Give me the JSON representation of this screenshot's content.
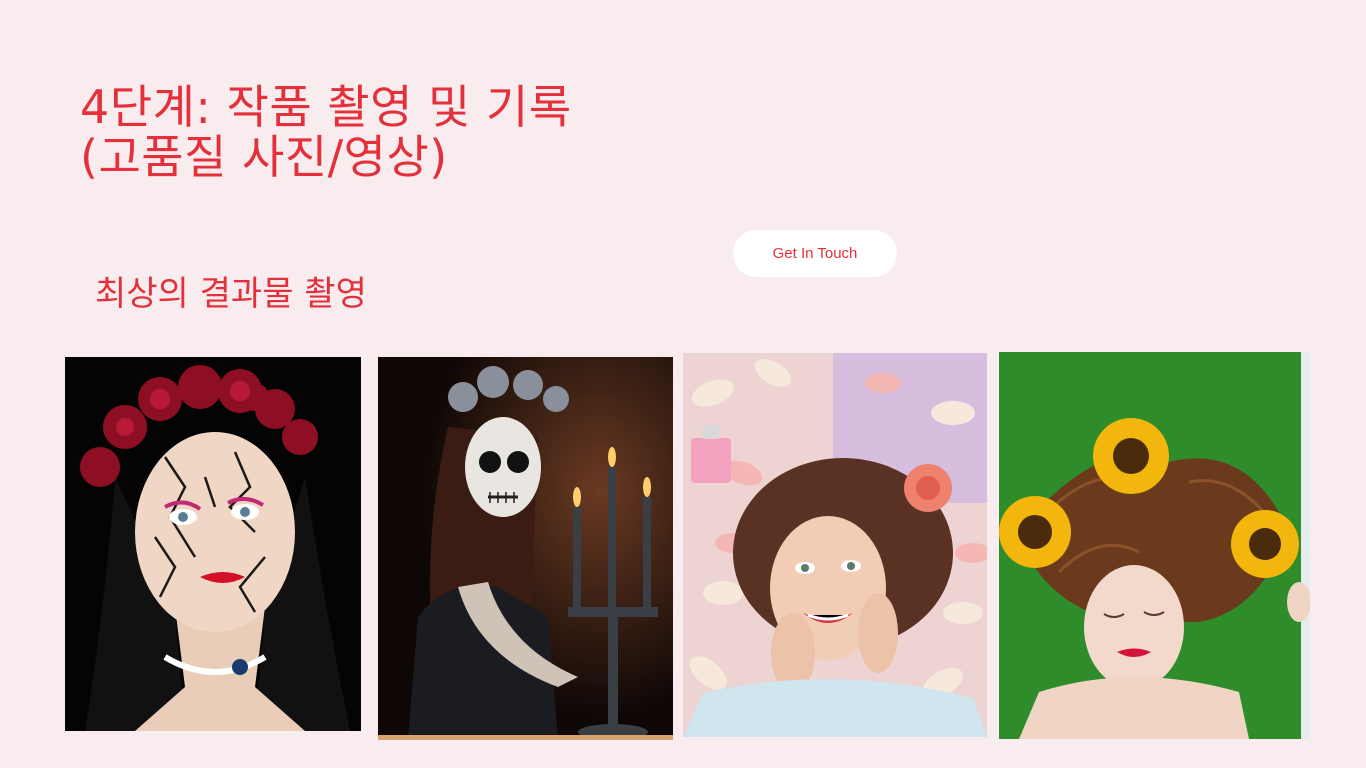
{
  "header": {
    "title": "4단계: 작품 촬영 및 기록\n(고품질 사진/영상)",
    "subtitle": "최상의 결과물 촬영"
  },
  "cta": {
    "label": "Get In Touch"
  },
  "colors": {
    "background": "#f8ecee",
    "accent": "#e4303a",
    "button_bg": "#ffffff"
  },
  "gallery": {
    "photos": [
      {
        "subject": "cracked-doll-makeup-with-red-rose-crown"
      },
      {
        "subject": "sugar-skull-makeup-with-candelabra"
      },
      {
        "subject": "smiling-woman-lying-on-flower-petals"
      },
      {
        "subject": "woman-lying-on-grass-with-sunflowers"
      }
    ]
  }
}
